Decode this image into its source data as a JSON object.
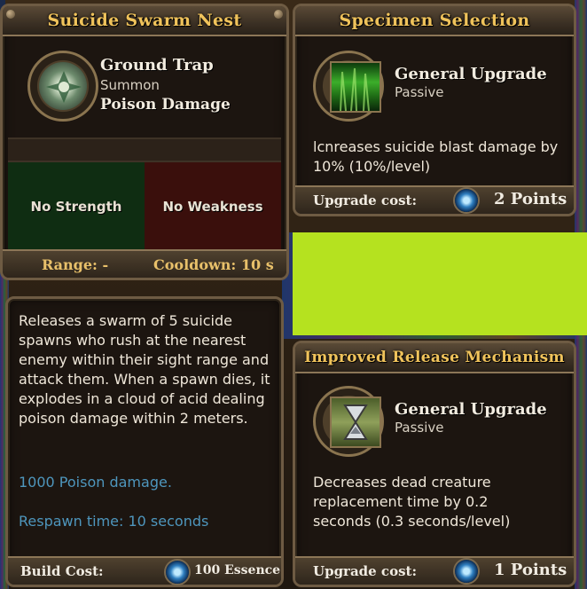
{
  "left_panel": {
    "title": "Suicide Swarm Nest",
    "icon": "ground-trap-icon",
    "name": "Ground Trap",
    "category": "Summon",
    "damage_type": "Poison Damage",
    "strength": "No Strength",
    "weakness": "No Weakness",
    "range": "Range: -",
    "cooldown": "Cooldown: 10 s",
    "description": "Releases a swarm of 5 suicide spawns who rush at the nearest enemy within their sight range and attack them. When a spawn dies, it explodes in a cloud of acid dealing poison damage within 2 meters.",
    "stat_damage": "1000 Poison damage.",
    "stat_respawn": "Respawn time: 10 seconds",
    "footer_label": "Build Cost:",
    "footer_value": "100 Essence"
  },
  "upgrade_top": {
    "title": "Specimen Selection",
    "icon": "green-specimen-icon",
    "name": "General Upgrade",
    "type": "Passive",
    "description": "lcnreases suicide blast damage by 10% (10%/level)",
    "footer_label": "Upgrade cost:",
    "footer_value": "2 Points"
  },
  "upgrade_bottom": {
    "title": "Improved Release Mechanism",
    "icon": "hourglass-icon",
    "name": "General Upgrade",
    "type": "Passive",
    "description": "Decreases dead creature replacement time by 0.2 seconds (0.3 seconds/level)",
    "footer_label": "Upgrade cost:",
    "footer_value": "1 Points"
  },
  "colors": {
    "title_gold": "#f0c35b",
    "strength_green": "#0f2d12",
    "weakness_red": "#3a0f0c",
    "highlight_block": "#b5e21f",
    "stat_blue": "#4e96bd"
  }
}
